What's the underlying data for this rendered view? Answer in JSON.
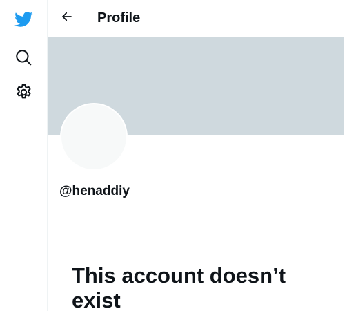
{
  "nav": {
    "items": [
      {
        "icon": "twitter-bird-icon",
        "label": ""
      },
      {
        "icon": "search-icon",
        "label": ""
      },
      {
        "icon": "gear-icon",
        "label": ""
      }
    ]
  },
  "header": {
    "title": "Profile"
  },
  "profile": {
    "handle": "@henaddiy"
  },
  "empty_state": {
    "title": "This account doesn’t exist"
  },
  "colors": {
    "brand": "#1d9bf0",
    "banner": "#cfd9de",
    "avatar": "#f7f9f9",
    "text": "#0f1419"
  }
}
